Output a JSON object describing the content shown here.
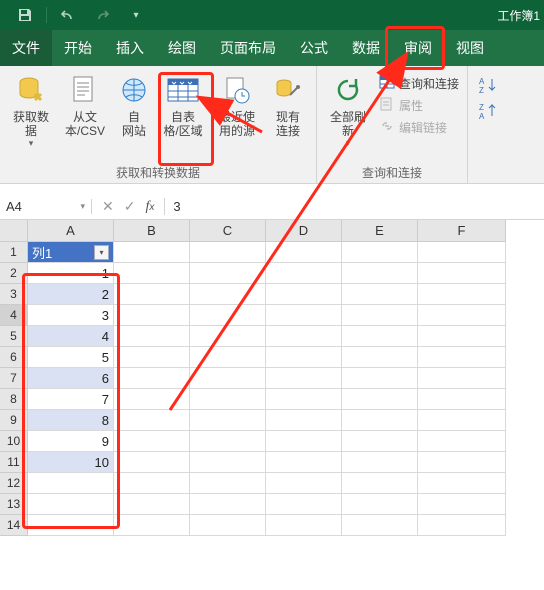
{
  "titlebar": {
    "doc_title": "工作簿1"
  },
  "tabs": {
    "file": "文件",
    "home": "开始",
    "insert": "插入",
    "draw": "绘图",
    "layout": "页面布局",
    "formulas": "公式",
    "data": "数据",
    "review": "审阅",
    "view": "视图"
  },
  "ribbon": {
    "group1_title": "获取和转换数据",
    "get_data": "获取数\n据",
    "from_csv": "从文\n本/CSV",
    "from_web": "自\n网站",
    "from_table": "自表\n格/区域",
    "recent": "最近使\n用的源",
    "existing": "现有\n连接",
    "group2_title": "查询和连接",
    "refresh_all": "全部刷\n新",
    "queries": "查询和连接",
    "properties": "属性",
    "edit_links": "编辑链接",
    "sort_group": {
      "az": "A",
      "za": "Z"
    }
  },
  "formula_bar": {
    "cell_ref": "A4",
    "value": "3"
  },
  "columns": [
    "A",
    "B",
    "C",
    "D",
    "E",
    "F"
  ],
  "table": {
    "header": "列1",
    "rows": [
      1,
      2,
      3,
      4,
      5,
      6,
      7,
      8,
      9,
      10
    ]
  },
  "row_count": 14,
  "chart_data": null
}
